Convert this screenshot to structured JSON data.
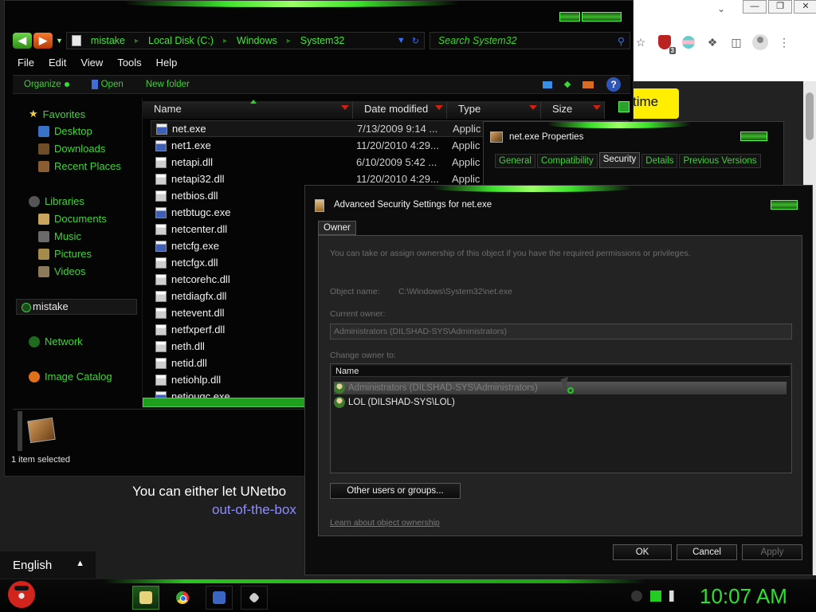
{
  "browser": {
    "badge_count": "3",
    "yellow_button_text": "time",
    "page_text_line1": "You can either let UNetbo",
    "page_text_line2": "out-of-the-box",
    "language": "English"
  },
  "explorer": {
    "breadcrumbs": [
      "mistake",
      "Local Disk (C:)",
      "Windows",
      "System32"
    ],
    "search_placeholder": "Search System32",
    "menu": [
      "File",
      "Edit",
      "View",
      "Tools",
      "Help"
    ],
    "commands": [
      "Organize",
      "Open",
      "New folder"
    ],
    "nav": {
      "favorites": "Favorites",
      "desktop": "Desktop",
      "downloads": "Downloads",
      "recent": "Recent Places",
      "libraries": "Libraries",
      "documents": "Documents",
      "music": "Music",
      "pictures": "Pictures",
      "videos": "Videos",
      "homegroup": "mistake",
      "network": "Network",
      "image_catalog": "Image Catalog"
    },
    "columns": [
      "Name",
      "Date modified",
      "Type",
      "Size"
    ],
    "files": [
      {
        "name": "net.exe",
        "date": "7/13/2009 9:14 ...",
        "type": "Applic"
      },
      {
        "name": "net1.exe",
        "date": "11/20/2010 4:29...",
        "type": "Applic"
      },
      {
        "name": "netapi.dll",
        "date": "6/10/2009 5:42 ...",
        "type": "Applic"
      },
      {
        "name": "netapi32.dll",
        "date": "11/20/2010 4:29...",
        "type": "Applic"
      },
      {
        "name": "netbios.dll",
        "date": "",
        "type": ""
      },
      {
        "name": "netbtugc.exe",
        "date": "",
        "type": ""
      },
      {
        "name": "netcenter.dll",
        "date": "",
        "type": ""
      },
      {
        "name": "netcfg.exe",
        "date": "",
        "type": ""
      },
      {
        "name": "netcfgx.dll",
        "date": "",
        "type": ""
      },
      {
        "name": "netcorehc.dll",
        "date": "",
        "type": ""
      },
      {
        "name": "netdiagfx.dll",
        "date": "",
        "type": ""
      },
      {
        "name": "netevent.dll",
        "date": "",
        "type": ""
      },
      {
        "name": "netfxperf.dll",
        "date": "",
        "type": ""
      },
      {
        "name": "neth.dll",
        "date": "",
        "type": ""
      },
      {
        "name": "netid.dll",
        "date": "",
        "type": ""
      },
      {
        "name": "netiohlp.dll",
        "date": "",
        "type": ""
      },
      {
        "name": "netiougc.exe",
        "date": "",
        "type": ""
      }
    ],
    "status": "1 item selected"
  },
  "properties": {
    "title": "net.exe Properties",
    "tabs": [
      "General",
      "Compatibility",
      "Security",
      "Details",
      "Previous Versions"
    ]
  },
  "advanced": {
    "title": "Advanced Security Settings for net.exe",
    "tab": "Owner",
    "intro": "You can take or assign ownership of this object if you have the required permissions or privileges.",
    "object_name_label": "Object name:",
    "object_name_value": "C:\\Windows\\System32\\net.exe",
    "current_owner_label": "Current owner:",
    "current_owner_value": "Administrators (DILSHAD-SYS\\Administrators)",
    "change_owner_label": "Change owner to:",
    "list_header": "Name",
    "owners": [
      "Administrators (DILSHAD-SYS\\Administrators)",
      "LOL (DILSHAD-SYS\\LOL)"
    ],
    "other_users_button": "Other users or groups...",
    "learn_link": "Learn about object ownership",
    "ok": "OK",
    "cancel": "Cancel",
    "apply": "Apply"
  },
  "taskbar": {
    "clock": "10:07 AM"
  },
  "colors": {
    "accent_green": "#3fd638",
    "clock_green": "#2ee02e",
    "dialog_bg": "#232323"
  }
}
